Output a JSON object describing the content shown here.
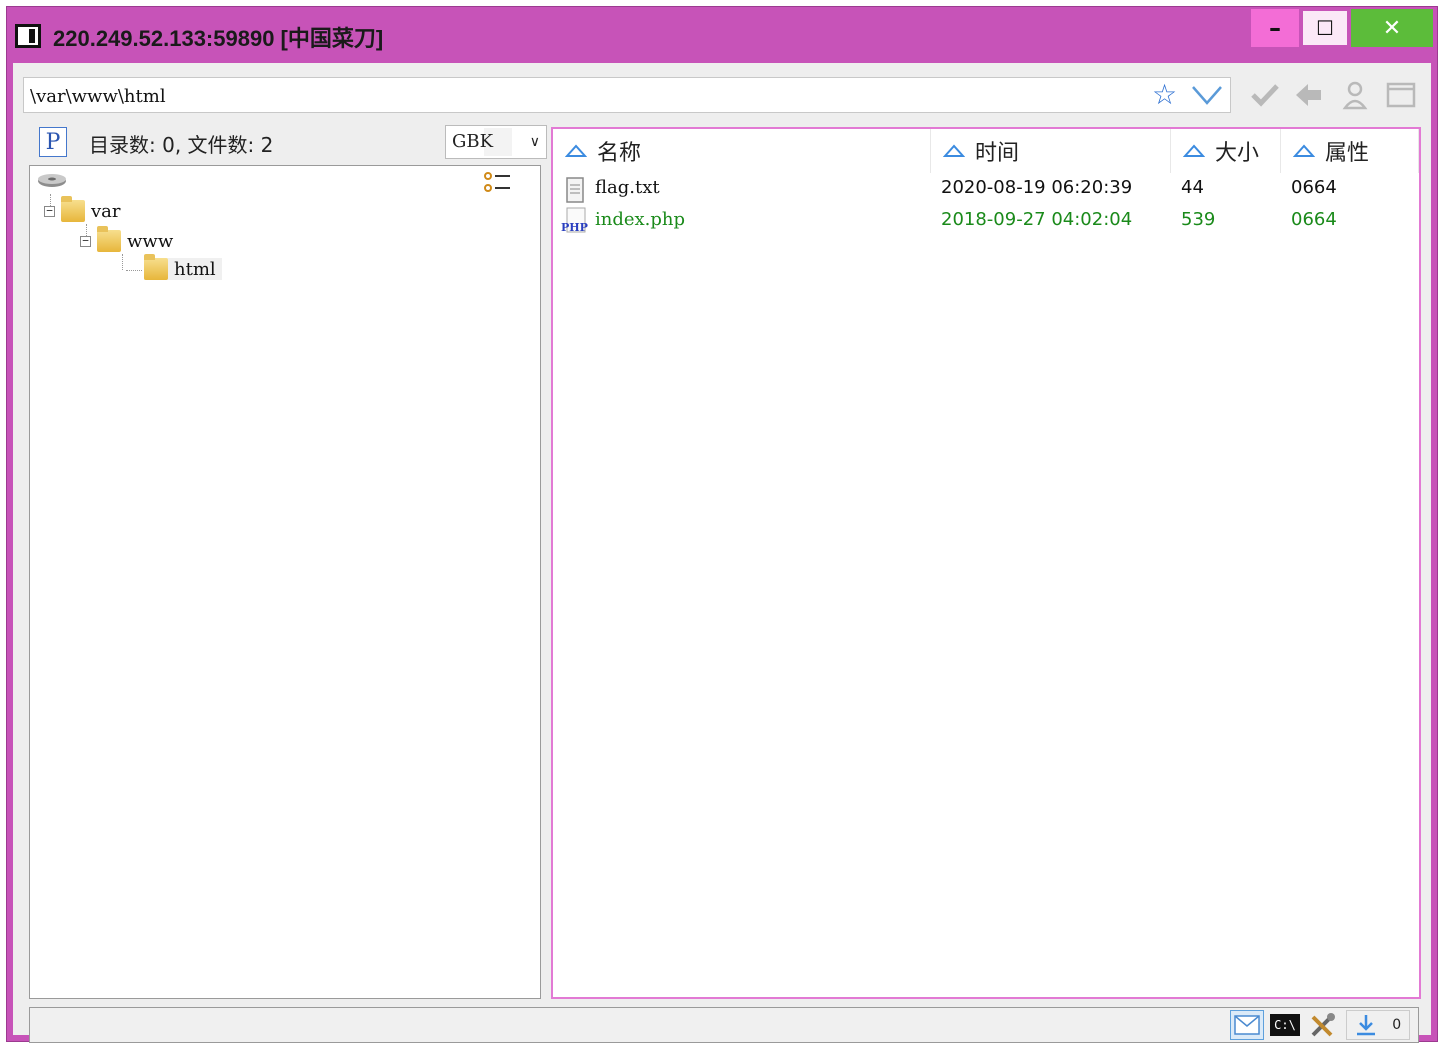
{
  "window": {
    "title": "220.249.52.133:59890 [中国菜刀]",
    "minimize_glyph": "–",
    "maximize_glyph": "☐",
    "close_glyph": "✕"
  },
  "address_bar": {
    "value": "\\var\\www\\html"
  },
  "left_panel": {
    "p_label": "P",
    "count_text": "目录数: 0, 文件数: 2",
    "encoding": "GBK",
    "dropdown_glyph": "∨"
  },
  "tree": {
    "items": [
      {
        "label": "var"
      },
      {
        "label": "www"
      },
      {
        "label": "html"
      }
    ]
  },
  "file_list": {
    "columns": [
      "名称",
      "时间",
      "大小",
      "属性"
    ],
    "rows": [
      {
        "name": "flag.txt",
        "time": "2020-08-19 06:20:39",
        "size": "44",
        "attr": "0664",
        "type": "txt"
      },
      {
        "name": "index.php",
        "time": "2018-09-27 04:02:04",
        "size": "539",
        "attr": "0664",
        "type": "php"
      }
    ]
  },
  "status_bar": {
    "cmd_label": "C:\\",
    "counter": "0"
  },
  "colors": {
    "titlebar": "#c753b8",
    "minimize_bg": "#f36dd6",
    "close_bg": "#5cbc3a",
    "php_text": "#1a8a1a",
    "file_pane_border": "#e27ad4"
  }
}
